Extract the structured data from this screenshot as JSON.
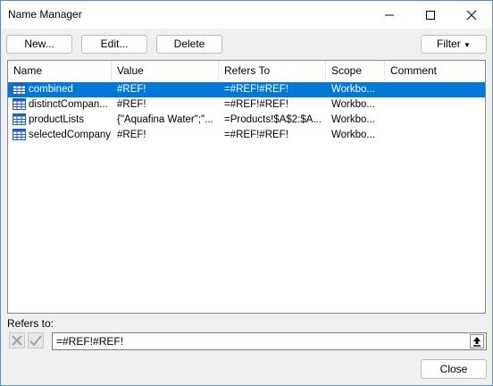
{
  "window": {
    "title": "Name Manager"
  },
  "toolbar": {
    "new_label": "New...",
    "edit_label": "Edit...",
    "delete_label": "Delete",
    "filter_label": "Filter"
  },
  "table": {
    "columns": [
      "Name",
      "Value",
      "Refers To",
      "Scope",
      "Comment"
    ],
    "rows": [
      {
        "name": "combined",
        "value": "#REF!",
        "refers_to": "=#REF!#REF!",
        "scope": "Workbo...",
        "comment": "",
        "selected": true
      },
      {
        "name": "distinctCompan...",
        "value": "#REF!",
        "refers_to": "=#REF!#REF!",
        "scope": "Workbo...",
        "comment": "",
        "selected": false
      },
      {
        "name": "productLists",
        "value": "{\"Aquafina Water\";\"...",
        "refers_to": "=Products!$A$2:$A...",
        "scope": "Workbo...",
        "comment": "",
        "selected": false
      },
      {
        "name": "selectedCompany",
        "value": "#REF!",
        "refers_to": "=#REF!#REF!",
        "scope": "Workbo...",
        "comment": "",
        "selected": false
      }
    ]
  },
  "refers_to": {
    "label": "Refers to:",
    "value": "=#REF!#REF!"
  },
  "footer": {
    "close_label": "Close"
  },
  "colors": {
    "selection": "#0078d7",
    "icon_blue": "#1f5fbf"
  },
  "icons": {
    "name_range": "grid-table-icon",
    "cancel": "x-icon",
    "confirm": "check-icon",
    "collapse": "collapse-dialog-icon"
  }
}
